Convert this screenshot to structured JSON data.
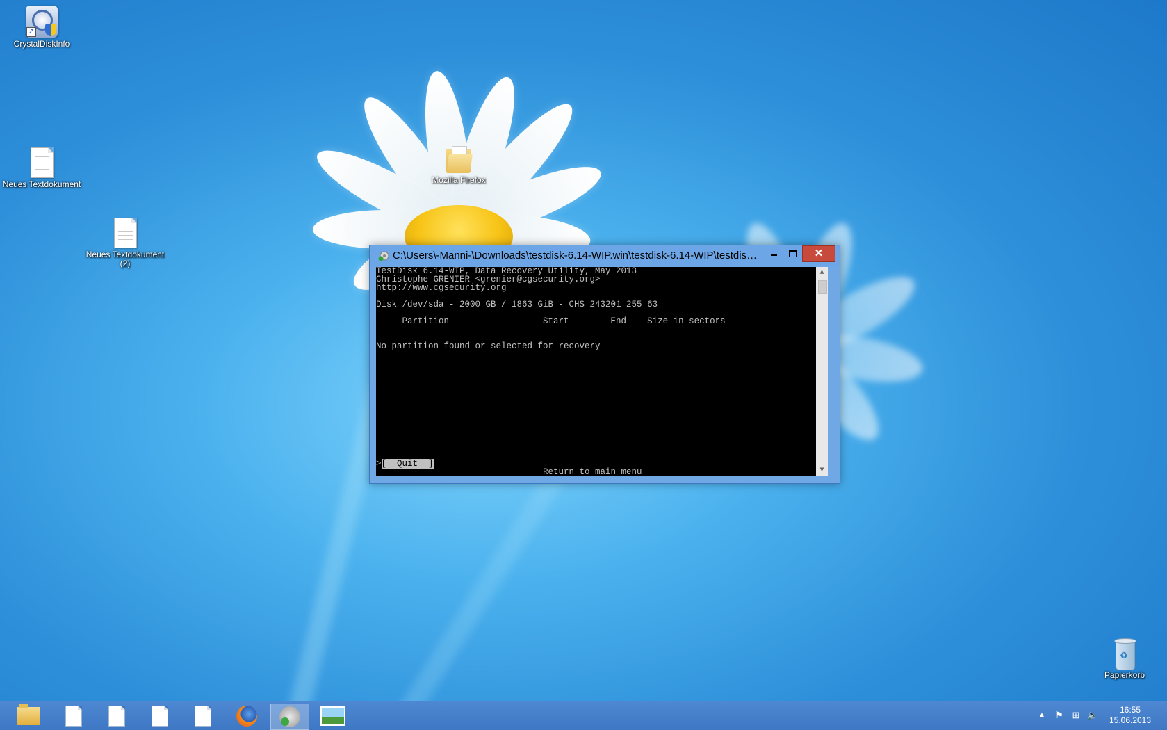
{
  "desktop": {
    "icons": {
      "crystaldiskinfo": "CrystalDiskInfo",
      "text_doc_1": "Neues Textdokument",
      "text_doc_2_line1": "Neues Textdokument",
      "text_doc_2_line2": "(2)",
      "firefox_folder": "Mozilla Firefox",
      "recycle_bin": "Papierkorb"
    }
  },
  "window": {
    "title": "C:\\Users\\-Manni-\\Downloads\\testdisk-6.14-WIP.win\\testdisk-6.14-WIP\\testdisk_...",
    "minimize_glyph": "minimize",
    "maximize_glyph": "maximize",
    "close_glyph": "✕"
  },
  "console": {
    "line1": "TestDisk 6.14-WIP, Data Recovery Utility, May 2013",
    "line2": "Christophe GRENIER <grenier@cgsecurity.org>",
    "line3": "http://www.cgsecurity.org",
    "disk_info": "Disk /dev/sda - 2000 GB / 1863 GiB - CHS 243201 255 63",
    "header": "     Partition                  Start        End    Size in sectors",
    "message": "No partition found or selected for recovery",
    "quit_prefix": ">",
    "quit_option": "[  Quit  ]",
    "hint": "Return to main menu"
  },
  "taskbar": {
    "buttons": [
      "file-explorer",
      "text-document",
      "text-document",
      "text-document",
      "text-document",
      "firefox",
      "testdisk",
      "photo-viewer"
    ],
    "active": "testdisk",
    "clock_time": "16:55",
    "clock_date": "15.06.2013"
  },
  "colors": {
    "console_bg": "#000000",
    "console_fg": "#c0c0c0",
    "close_button": "#c74a3c",
    "window_frame": "#6ca6e6",
    "taskbar": "#3e77c3"
  }
}
